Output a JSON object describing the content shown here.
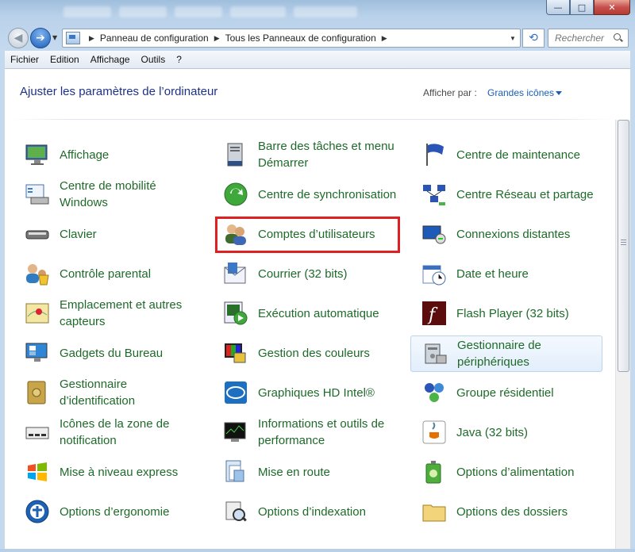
{
  "window": {
    "minimize": "—",
    "maximize": "□",
    "close": "✕"
  },
  "nav": {
    "breadcrumbs": [
      "Panneau de configuration",
      "Tous les Panneaux de configuration"
    ],
    "search_placeholder": "Rechercher"
  },
  "menu": [
    "Fichier",
    "Edition",
    "Affichage",
    "Outils",
    "?"
  ],
  "content": {
    "heading": "Ajuster les paramètres de l’ordinateur",
    "view_by_label": "Afficher par :",
    "view_by_value": "Grandes icônes"
  },
  "colors": {
    "item_text": "#1f6a2a",
    "heading": "#1e3287",
    "highlight_box": "#e02020"
  },
  "items": [
    {
      "label": "Affichage",
      "icon": "display-icon"
    },
    {
      "label": "Barre des tâches et menu Démarrer",
      "icon": "taskbar-icon"
    },
    {
      "label": "Centre de maintenance",
      "icon": "flag-icon"
    },
    {
      "label": "Centre de mobilité Windows",
      "icon": "mobility-icon"
    },
    {
      "label": "Centre de synchronisation",
      "icon": "sync-icon"
    },
    {
      "label": "Centre Réseau et partage",
      "icon": "network-icon"
    },
    {
      "label": "Clavier",
      "icon": "keyboard-icon"
    },
    {
      "label": "Comptes d’utilisateurs",
      "icon": "users-icon"
    },
    {
      "label": "Connexions distantes",
      "icon": "remote-icon"
    },
    {
      "label": "Contrôle parental",
      "icon": "parental-icon"
    },
    {
      "label": "Courrier (32 bits)",
      "icon": "mail-icon"
    },
    {
      "label": "Date et heure",
      "icon": "calendar-icon"
    },
    {
      "label": "Emplacement et autres capteurs",
      "icon": "location-icon"
    },
    {
      "label": "Exécution automatique",
      "icon": "autoplay-icon"
    },
    {
      "label": "Flash Player (32 bits)",
      "icon": "flash-icon"
    },
    {
      "label": "Gadgets du Bureau",
      "icon": "gadgets-icon"
    },
    {
      "label": "Gestion des couleurs",
      "icon": "color-icon"
    },
    {
      "label": "Gestionnaire de périphériques",
      "icon": "devices-icon"
    },
    {
      "label": "Gestionnaire d’identification",
      "icon": "vault-icon"
    },
    {
      "label": "Graphiques HD Intel®",
      "icon": "intel-icon"
    },
    {
      "label": "Groupe résidentiel",
      "icon": "homegroup-icon"
    },
    {
      "label": "Icônes de la zone de notification",
      "icon": "tray-icon"
    },
    {
      "label": "Informations et outils de performance",
      "icon": "performance-icon"
    },
    {
      "label": "Java (32 bits)",
      "icon": "java-icon"
    },
    {
      "label": "Mise à niveau express",
      "icon": "windows-icon"
    },
    {
      "label": "Mise en route",
      "icon": "getting-started-icon"
    },
    {
      "label": "Options d’alimentation",
      "icon": "power-icon"
    },
    {
      "label": "Options d’ergonomie",
      "icon": "ease-icon"
    },
    {
      "label": "Options d’indexation",
      "icon": "index-icon"
    },
    {
      "label": "Options des dossiers",
      "icon": "folder-icon"
    }
  ]
}
